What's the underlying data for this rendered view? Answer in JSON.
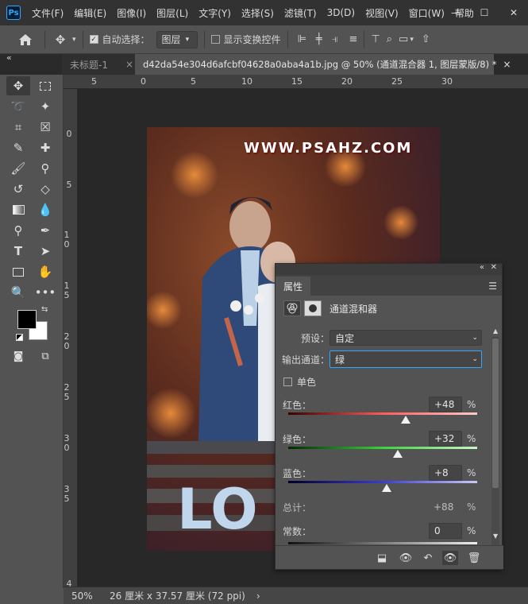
{
  "app": {
    "logo": "Ps"
  },
  "menu": [
    "文件(F)",
    "编辑(E)",
    "图像(I)",
    "图层(L)",
    "文字(Y)",
    "选择(S)",
    "滤镜(T)",
    "3D(D)",
    "视图(V)",
    "窗口(W)",
    "帮助"
  ],
  "window_controls": {
    "minimize": "—",
    "maximize": "☐",
    "close": "✕"
  },
  "options": {
    "home_icon": "home-icon",
    "auto_select_label": "自动选择：",
    "auto_select_checked": true,
    "auto_select_target": "图层",
    "show_transform_label": "显示变换控件",
    "show_transform_checked": false
  },
  "tabs": [
    {
      "title": "未标题-1",
      "close": "×",
      "active": false
    },
    {
      "title": "d42da54e304d6afcbf04628a0aba4a1b.jpg @ 50% (通道混合器 1, 图层蒙版/8) *",
      "close": "×",
      "active": true
    }
  ],
  "rulers": {
    "top": [
      "5",
      "0",
      "5",
      "10",
      "15",
      "20",
      "25",
      "30"
    ],
    "left": [
      "0",
      "5",
      "10",
      "15",
      "20",
      "25",
      "30",
      "35",
      "4"
    ]
  },
  "canvas": {
    "watermark": "WWW.PSAHZ.COM",
    "bench_letters": "LO"
  },
  "status": {
    "zoom": "50%",
    "doc_info": "26 厘米 x 37.57 厘米 (72 ppi)",
    "arrow": "›"
  },
  "properties": {
    "panel_title": "属性",
    "adjustment_name": "通道混和器",
    "preset_label": "预设：",
    "preset_value": "自定",
    "output_label": "输出通道：",
    "output_value": "绿",
    "monochrome_label": "单色",
    "monochrome_checked": false,
    "sliders": [
      {
        "label": "红色：",
        "value": "+48",
        "unit": "%",
        "percent": 48
      },
      {
        "label": "绿色：",
        "value": "+32",
        "unit": "%",
        "percent": 32
      },
      {
        "label": "蓝色：",
        "value": "+8",
        "unit": "%",
        "percent": 8
      }
    ],
    "total_label": "总计：",
    "total_value": "+88",
    "total_unit": "%",
    "constant_label": "常数：",
    "constant_value": "0",
    "constant_unit": "%"
  },
  "colors": {
    "accent": "#31a8ff",
    "panel": "#535353",
    "canvas_bg": "#282828"
  }
}
